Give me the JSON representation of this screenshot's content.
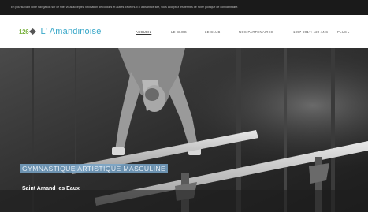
{
  "cookie_notice": "En poursuivant votre navigation sur ce site, vous acceptez l'utilisation de cookies et autres traceurs. En utilisant ce site, vous acceptez les termes de notre politique de confidentialité.",
  "logo": {
    "badge": "126",
    "name": "L' Amandinoise"
  },
  "nav": {
    "items": [
      "ACCUEIL",
      "LE BLOG",
      "LE CLUB",
      "NOS PARTENAIRES",
      "1897-2017: 120 ANS",
      "PLUS"
    ],
    "active": "ACCUEIL"
  },
  "hero": {
    "title": "GYMNASTIQUE ARTISTIQUE MASCULINE",
    "subtitle": "Saint Amand les Eaux"
  },
  "colors": {
    "logo_blue": "#3aa8c9",
    "logo_green": "#7cb342",
    "title_band": "#78a5c8"
  }
}
